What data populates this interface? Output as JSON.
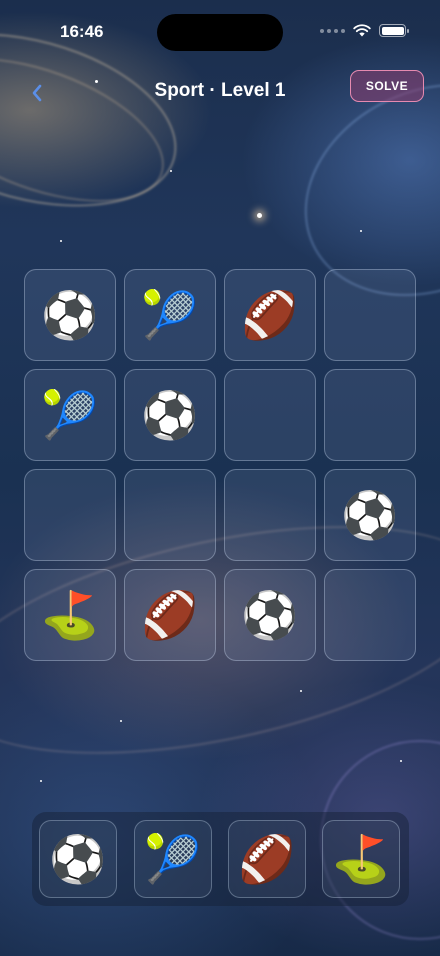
{
  "status": {
    "time": "16:46"
  },
  "header": {
    "title": "Sport · Level 1",
    "solve_label": "SOLVE"
  },
  "board": {
    "cells": [
      "⚽",
      "🎾",
      "🏈",
      "",
      "🎾",
      "⚽",
      "",
      "",
      "",
      "",
      "",
      "⚽",
      "⛳",
      "🏈",
      "⚽",
      ""
    ]
  },
  "tray": {
    "items": [
      "⚽",
      "🎾",
      "🏈",
      "⛳"
    ]
  },
  "colors": {
    "accent": "#e68ab0",
    "back_chevron": "#5b8fe8"
  }
}
